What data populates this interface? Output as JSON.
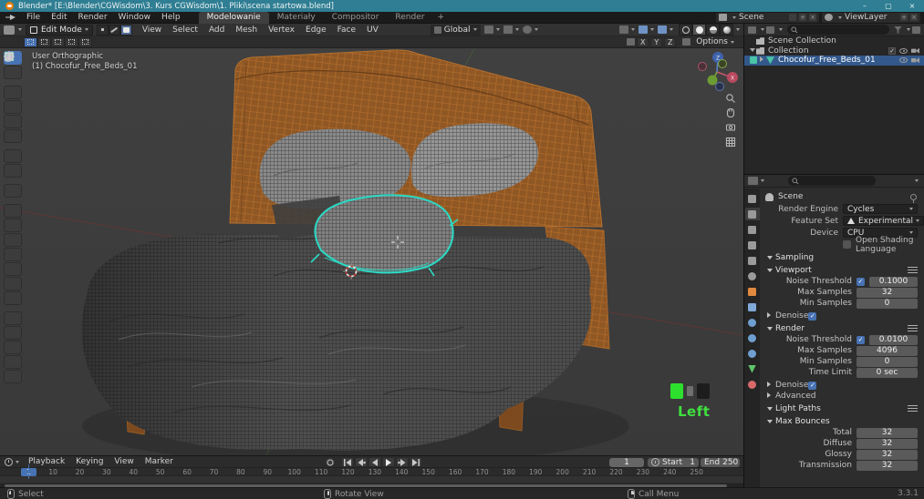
{
  "colors": {
    "accent": "#4772b3",
    "selection_teal": "#2bd9c4",
    "wood": "#c8813c",
    "keycast_green": "#3fe03f",
    "titlebar_teal": "#2f7e93"
  },
  "titlebar": {
    "title": "Blender* [E:\\Blender\\CGWisdom\\3. Kurs CGWisdom\\1. Pliki\\scena startowa.blend]",
    "controls": {
      "minimize": "–",
      "maximize": "▢",
      "close": "×"
    }
  },
  "topbar": {
    "menus": [
      "File",
      "Edit",
      "Render",
      "Window",
      "Help"
    ],
    "workspaces": [
      {
        "label": "Modelowanie",
        "active": true
      },
      {
        "label": "Materiały"
      },
      {
        "label": "Compositor"
      },
      {
        "label": "Render"
      }
    ],
    "new_workspace": "+",
    "scene": "Scene",
    "view_layer": "ViewLayer"
  },
  "viewport_header": {
    "mode": "Edit Mode",
    "menus": [
      "View",
      "Select",
      "Add",
      "Mesh",
      "Vertex",
      "Edge",
      "Face",
      "UV"
    ],
    "orientation": "Global",
    "select_modes": [
      {
        "name": "vertex"
      },
      {
        "name": "edge"
      },
      {
        "name": "face",
        "active": true
      }
    ],
    "shading": [
      {
        "name": "wireframe"
      },
      {
        "name": "solid",
        "active": true
      },
      {
        "name": "material"
      },
      {
        "name": "rendered"
      }
    ]
  },
  "tool_settings": {
    "select_options": [
      {
        "name": "new",
        "active": true
      },
      {
        "name": "extend"
      },
      {
        "name": "subtract"
      },
      {
        "name": "invert"
      },
      {
        "name": "intersect"
      }
    ],
    "mirror_axes": [
      "X",
      "Y",
      "Z"
    ],
    "options_label": "Options"
  },
  "toolbar": [
    {
      "name": "box-select",
      "active": true
    },
    {
      "name": "cursor"
    },
    {
      "name": "move",
      "gap": true
    },
    {
      "name": "rotate"
    },
    {
      "name": "scale"
    },
    {
      "name": "transform"
    },
    {
      "name": "annotate",
      "gap": true
    },
    {
      "name": "measure"
    },
    {
      "name": "add-cube",
      "gap": true
    },
    {
      "name": "extrude-region",
      "gap": true
    },
    {
      "name": "inset-faces"
    },
    {
      "name": "bevel"
    },
    {
      "name": "loop-cut"
    },
    {
      "name": "knife"
    },
    {
      "name": "poly-build"
    },
    {
      "name": "spin"
    },
    {
      "name": "smooth",
      "gap": true
    },
    {
      "name": "edge-slide"
    },
    {
      "name": "shrink-fatten"
    },
    {
      "name": "shear"
    },
    {
      "name": "rip-region"
    }
  ],
  "viewport": {
    "view_label": "User Orthographic",
    "object_label": "(1) Chocofur_Free_Beds_01",
    "keycast_label": "Left",
    "gizmo": {
      "x": "X",
      "z": "Z"
    }
  },
  "outliner": {
    "rows": [
      {
        "label": "Scene Collection",
        "depth": 0,
        "icon": "collection"
      },
      {
        "label": "Collection",
        "depth": 1,
        "icon": "collection",
        "arrow": "down",
        "show_toggle": true,
        "show_eye": true,
        "show_cam": true
      },
      {
        "label": "Chocofur_Free_Beds_01",
        "depth": 2,
        "icon": "mesh",
        "arrow": "right",
        "selected": true,
        "edit_badge": true,
        "show_eye": true,
        "show_cam": true
      }
    ]
  },
  "properties": {
    "tabs": [
      {
        "name": "tool"
      },
      {
        "name": "render",
        "active": true
      },
      {
        "name": "output"
      },
      {
        "name": "view-layer"
      },
      {
        "name": "scene"
      },
      {
        "name": "world"
      },
      {
        "name": "object"
      },
      {
        "name": "modifiers"
      },
      {
        "name": "particles"
      },
      {
        "name": "physics"
      },
      {
        "name": "constraints"
      },
      {
        "name": "object-data"
      },
      {
        "name": "material"
      }
    ],
    "breadcrumb": "Scene",
    "fields": [
      {
        "label": "Render Engine",
        "value": "Cycles"
      },
      {
        "label": "Feature Set",
        "value": "Experimental",
        "warning": true
      },
      {
        "label": "Device",
        "value": "CPU"
      }
    ],
    "osl_label": "Open Shading Language",
    "rows": [
      {
        "type": "section",
        "indent": 0,
        "label": "Sampling"
      },
      {
        "type": "section",
        "indent": 1,
        "label": "Viewport",
        "preset": true
      },
      {
        "type": "checkval",
        "indent": 2,
        "label": "Noise Threshold",
        "checked": true,
        "value": "0.1000"
      },
      {
        "type": "value",
        "indent": 2,
        "label": "Max Samples",
        "value": "32"
      },
      {
        "type": "value",
        "indent": 2,
        "label": "Min Samples",
        "value": "0"
      },
      {
        "type": "check",
        "indent": 1,
        "label": "Denoise",
        "checked": true
      },
      {
        "type": "section",
        "indent": 1,
        "label": "Render",
        "preset": true
      },
      {
        "type": "checkval",
        "indent": 2,
        "label": "Noise Threshold",
        "checked": true,
        "value": "0.0100"
      },
      {
        "type": "value",
        "indent": 2,
        "label": "Max Samples",
        "value": "4096"
      },
      {
        "type": "value",
        "indent": 2,
        "label": "Min Samples",
        "value": "0"
      },
      {
        "type": "value",
        "indent": 2,
        "label": "Time Limit",
        "value": "0 sec"
      },
      {
        "type": "check",
        "indent": 1,
        "label": "Denoise",
        "checked": true
      },
      {
        "type": "collapsed",
        "indent": 1,
        "label": "Advanced"
      },
      {
        "type": "section",
        "indent": 0,
        "label": "Light Paths",
        "preset": true
      },
      {
        "type": "section",
        "indent": 1,
        "label": "Max Bounces"
      },
      {
        "type": "value",
        "indent": 2,
        "label": "Total",
        "value": "32"
      },
      {
        "type": "value",
        "indent": 2,
        "label": "Diffuse",
        "value": "32"
      },
      {
        "type": "value",
        "indent": 2,
        "label": "Glossy",
        "value": "32"
      },
      {
        "type": "value",
        "indent": 2,
        "label": "Transmission",
        "value": "32"
      }
    ]
  },
  "timeline": {
    "menus": [
      "Playback",
      "Keying",
      "View",
      "Marker"
    ],
    "current_frame": "1",
    "start_label": "Start",
    "start_value": "1",
    "end_label": "End",
    "end_value": "250",
    "ticks": [
      10,
      20,
      30,
      40,
      50,
      60,
      70,
      80,
      90,
      100,
      110,
      120,
      130,
      140,
      150,
      160,
      170,
      180,
      190,
      200,
      210,
      220,
      230,
      240,
      250
    ]
  },
  "statusbar": {
    "hints": [
      {
        "label": "Select",
        "button": "left"
      },
      {
        "label": "Rotate View",
        "button": "middle"
      },
      {
        "label": "Call Menu",
        "button": "right"
      }
    ],
    "version": "3.3.1"
  }
}
